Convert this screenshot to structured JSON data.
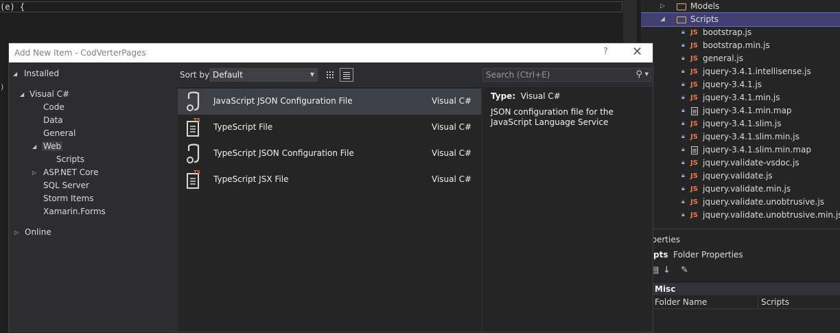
{
  "editor": {
    "code_line": "(e) {",
    "gutter_glyph": ")"
  },
  "solution_explorer": {
    "folders": [
      {
        "label": "Models",
        "expanded": false
      },
      {
        "label": "Scripts",
        "expanded": true,
        "selected": true
      }
    ],
    "files": [
      {
        "label": "bootstrap.js",
        "type": "js"
      },
      {
        "label": "bootstrap.min.js",
        "type": "js"
      },
      {
        "label": "general.js",
        "type": "js"
      },
      {
        "label": "jquery-3.4.1.intellisense.js",
        "type": "js"
      },
      {
        "label": "jquery-3.4.1.js",
        "type": "js"
      },
      {
        "label": "jquery-3.4.1.min.js",
        "type": "js"
      },
      {
        "label": "jquery-3.4.1.min.map",
        "type": "map"
      },
      {
        "label": "jquery-3.4.1.slim.js",
        "type": "js"
      },
      {
        "label": "jquery-3.4.1.slim.min.js",
        "type": "js"
      },
      {
        "label": "jquery-3.4.1.slim.min.map",
        "type": "map"
      },
      {
        "label": "jquery.validate-vsdoc.js",
        "type": "js"
      },
      {
        "label": "jquery.validate.js",
        "type": "js"
      },
      {
        "label": "jquery.validate.min.js",
        "type": "js"
      },
      {
        "label": "jquery.validate.unobtrusive.js",
        "type": "js"
      },
      {
        "label": "jquery.validate.unobtrusive.min.js",
        "type": "js"
      }
    ],
    "js_badge": "JS"
  },
  "properties": {
    "title": "operties",
    "subject": "ripts",
    "subject_type": "Folder Properties",
    "category": "Misc",
    "rows": [
      {
        "key": "Folder Name",
        "value": "Scripts"
      }
    ]
  },
  "dialog": {
    "title": "Add New Item - CodVerterPages",
    "help": "?",
    "close": "✕",
    "tree": {
      "installed": "Installed",
      "visual_csharp": "Visual C#",
      "code": "Code",
      "data": "Data",
      "general": "General",
      "web": "Web",
      "scripts": "Scripts",
      "aspnet_core": "ASP.NET Core",
      "sql_server": "SQL Server",
      "storm_items": "Storm Items",
      "xamarin_forms": "Xamarin.Forms",
      "online": "Online"
    },
    "sort": {
      "label": "Sort by:",
      "value": "Default"
    },
    "search": {
      "placeholder": "Search (Ctrl+E)"
    },
    "items": [
      {
        "name": "JavaScript JSON Configuration File",
        "lang": "Visual C#",
        "icon": "json-config-icon",
        "selected": true
      },
      {
        "name": "TypeScript File",
        "lang": "Visual C#",
        "icon": "ts-file-icon",
        "selected": false
      },
      {
        "name": "TypeScript JSON Configuration File",
        "lang": "Visual C#",
        "icon": "json-config-icon",
        "selected": false
      },
      {
        "name": "TypeScript JSX File",
        "lang": "Visual C#",
        "icon": "ts-file-icon",
        "selected": false
      }
    ],
    "details": {
      "type_label": "Type:",
      "type_value": "Visual C#",
      "description": "JSON configuration file for the JavaScript Language Service"
    },
    "ts_badge": "TS"
  },
  "colors": {
    "selection": "#3f3f70",
    "js_badge": "#e8794b",
    "ts_badge": "#e8794b",
    "folder": "#d9b45a"
  }
}
